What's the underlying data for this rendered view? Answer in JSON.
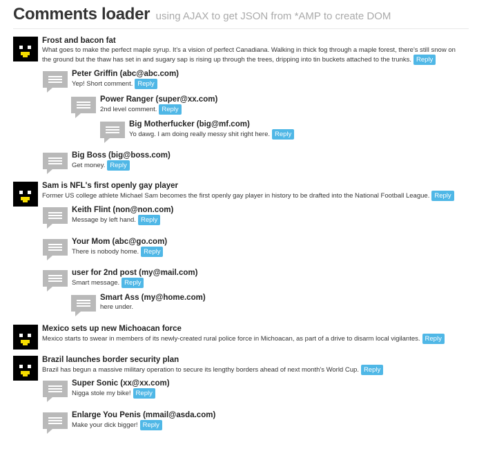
{
  "header": {
    "title": "Comments loader",
    "subtitle": "using AJAX to get JSON from *AMP to create DOM"
  },
  "reply_label": "Reply",
  "posts": [
    {
      "title": "Frost and bacon fat",
      "text": "What goes to make the perfect maple syrup. It's a vision of perfect Canadiana. Walking in thick fog through a maple forest, there's still snow on the ground but the thaw has set in and sugary sap is rising up through the trees, dripping into tin buckets attached to the trunks.",
      "comments": [
        {
          "author": "Peter Griffin (abc@abc.com)",
          "text": "Yep! Short comment."
        },
        {
          "author": "Power Ranger (super@xx.com)",
          "text": "2nd level comment."
        },
        {
          "author": "Big Motherfucker (big@mf.com)",
          "text": "Yo dawg. I am doing really messy shit right here."
        },
        {
          "author": "Big Boss (big@boss.com)",
          "text": "Get money."
        }
      ]
    },
    {
      "title": "Sam is NFL's first openly gay player",
      "text": "Former US college athlete Michael Sam becomes the first openly gay player in history to be drafted into the National Football League.",
      "comments": [
        {
          "author": "Keith Flint (non@non.com)",
          "text": "Message by left hand."
        },
        {
          "author": "Your Mom (abc@go.com)",
          "text": "There is nobody home."
        },
        {
          "author": "user for 2nd post (my@mail.com)",
          "text": "Smart message."
        },
        {
          "author": "Smart Ass (my@home.com)",
          "text": "here under."
        }
      ]
    },
    {
      "title": "Mexico sets up new Michoacan force",
      "text": "Mexico starts to swear in members of its newly-created rural police force in Michoacan, as part of a drive to disarm local vigilantes.",
      "comments": []
    },
    {
      "title": "Brazil launches border security plan",
      "text": "Brazil has begun a massive military operation to secure its lengthy borders ahead of next month's World Cup.",
      "comments": [
        {
          "author": "Super Sonic (xx@xx.com)",
          "text": "Nigga stole my bike!"
        },
        {
          "author": "Enlarge You Penis (mmail@asda.com)",
          "text": "Make your dick bigger!"
        }
      ]
    }
  ]
}
